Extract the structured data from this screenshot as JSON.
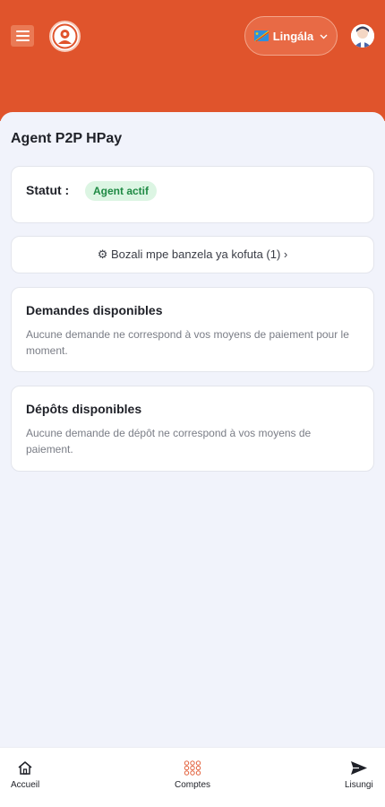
{
  "header": {
    "language_label": "Lingála",
    "flag_icon": "drc-flag-icon"
  },
  "main": {
    "title": "Agent P2P HPay",
    "status": {
      "label": "Statut :",
      "badge": "Agent actif"
    },
    "settings_link": "⚙ Bozali mpe banzela ya kofuta (1) ›",
    "demandes": {
      "title": "Demandes disponibles",
      "empty_text": "Aucune demande ne correspond à vos moyens de paiement pour le moment."
    },
    "depots": {
      "title": "Dépôts disponibles",
      "empty_text": "Aucune demande de dépôt ne correspond à vos moyens de paiement."
    }
  },
  "bottom_nav": {
    "items": [
      {
        "label": "Accueil",
        "icon": "home-icon"
      },
      {
        "label": "Comptes",
        "icon": "grid-icon"
      },
      {
        "label": "Lisungi",
        "icon": "send-icon"
      }
    ]
  },
  "colors": {
    "brand": "#e0542c",
    "success_bg": "#dcf5e3",
    "success_text": "#1f8a44",
    "page_bg": "#f1f3fb"
  }
}
